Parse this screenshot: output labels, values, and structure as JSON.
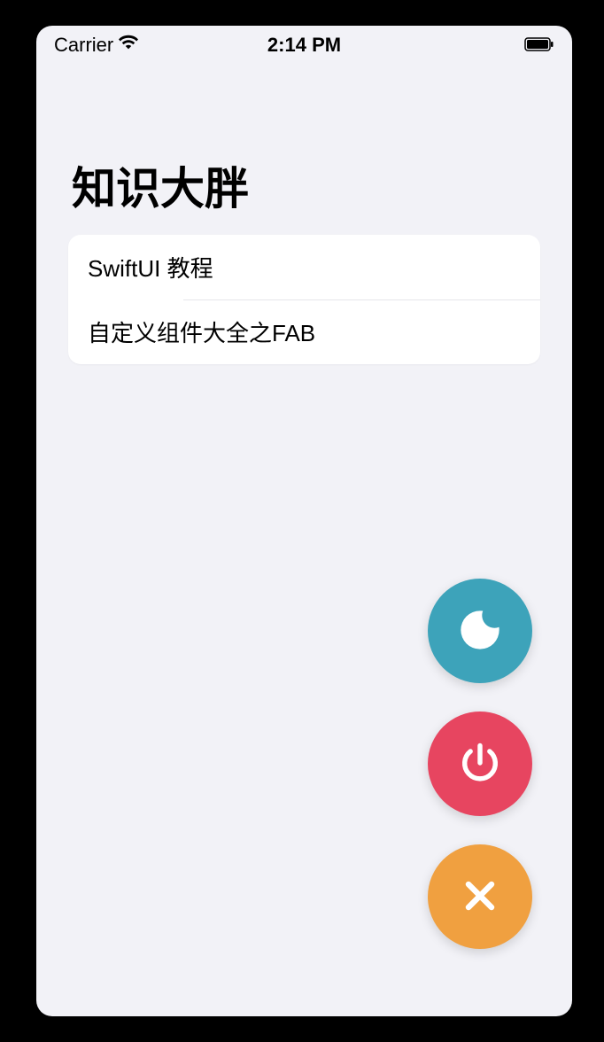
{
  "statusBar": {
    "carrier": "Carrier",
    "time": "2:14 PM"
  },
  "page": {
    "title": "知识大胖"
  },
  "list": {
    "items": [
      {
        "label": "SwiftUI 教程"
      },
      {
        "label": "自定义组件大全之FAB"
      }
    ]
  },
  "fab": {
    "moon": "moon-icon",
    "power": "power-icon",
    "close": "close-icon"
  },
  "colors": {
    "teal": "#3da3ba",
    "red": "#e74560",
    "orange": "#f0a040"
  }
}
